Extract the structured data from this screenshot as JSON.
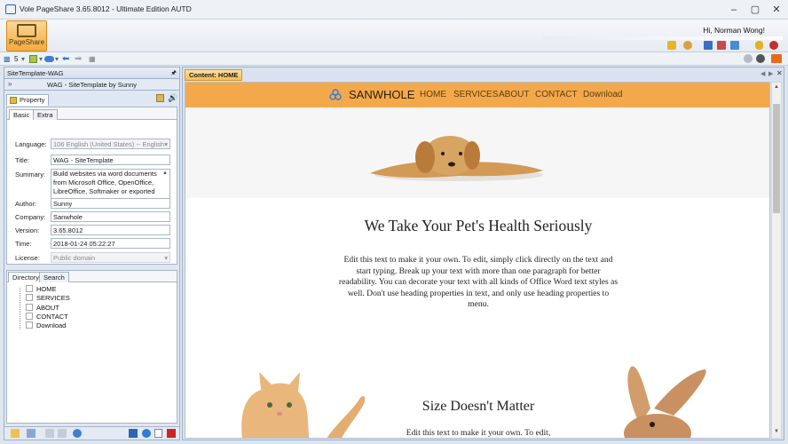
{
  "window": {
    "title": "Vole PageShare  3.65.8012 - Ultimate Edition AUTD",
    "min_glyph": "–",
    "max_glyph": "▢",
    "close_glyph": "✕"
  },
  "ribbon": {
    "pageshare_label": "PageShare",
    "greeting": "Hi, Norman Wong!"
  },
  "quickbar": {
    "counter": "5"
  },
  "left_panel": {
    "header": "SiteTemplate-WAG",
    "subheader": "WAG - SiteTemplate by Sunny",
    "property_tab": "Property",
    "tabs": [
      "Basic",
      "Extra"
    ],
    "fields": {
      "language_label": "Language:",
      "language_value": "106 English (United States) -- English",
      "title_label": "Title:",
      "title_value": "WAG - SiteTemplate",
      "summary_label": "Summary:",
      "summary_value": "Build websites via word documents from Microsoft Office, OpenOffice, LibreOffice, Softmaker or exported",
      "author_label": "Author:",
      "author_value": "Sunny",
      "company_label": "Company:",
      "company_value": "Sanwhole",
      "version_label": "Version:",
      "version_value": "3.65.8012",
      "time_label": "Time:",
      "time_value": "2018-01-24 05:22:27",
      "license_label": "License:",
      "license_value": "Public domain"
    },
    "bottom_tabs": [
      "Directory",
      "Search"
    ],
    "directory": [
      "HOME",
      "SERVICES",
      "ABOUT",
      "CONTACT",
      "Download"
    ]
  },
  "content": {
    "tab_label": "Content: HOME",
    "site": {
      "brand": "SANWHOLE",
      "nav": [
        "HOME",
        "SERVICES",
        "ABOUT",
        "CONTACT",
        "Download"
      ],
      "heading1": "We Take Your Pet's Health Seriously",
      "paragraph1": "Edit this text to make it your own. To edit, simply click directly on the text and start typing. Break up your text with more than one paragraph for better readability. You can decorate your text with all kinds of Office Word text styles as well. Don't use heading properties in text, and only use heading properties to menu.",
      "heading2": "Size Doesn't Matter",
      "paragraph2": "Edit this text to make it your own. To edit,"
    }
  },
  "colors": {
    "accent_orange": "#f3a94b",
    "nav_text": "#5c3d13",
    "brand_icon": "#3a7bd5"
  }
}
